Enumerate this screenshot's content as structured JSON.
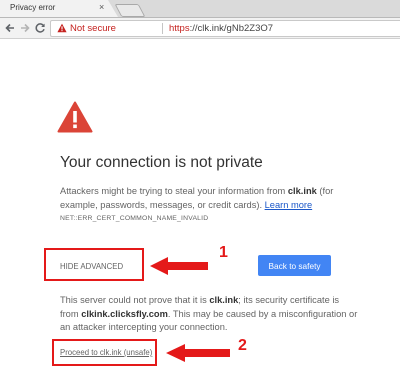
{
  "browser": {
    "tab_title": "Privacy error",
    "tab_close": "×",
    "security_label": "Not secure",
    "url_scheme": "https",
    "url_rest": "://clk.ink/gNb2Z3O7"
  },
  "page": {
    "heading": "Your connection is not private",
    "description_prefix": "Attackers might be trying to steal your information from ",
    "description_host": "clk.ink",
    "description_suffix": " (for example, passwords, messages, or credit cards). ",
    "learn_more": "Learn more",
    "error_code": "NET::ERR_CERT_COMMON_NAME_INVALID",
    "hide_advanced": "HIDE ADVANCED",
    "back_to_safety": "Back to safety",
    "detail_prefix": "This server could not prove that it is ",
    "detail_host": "clk.ink",
    "detail_mid": "; its security certificate is from ",
    "detail_cert_host": "clkink.clicksfly.com",
    "detail_suffix": ". This may be caused by a misconfiguration or an attacker intercepting your connection.",
    "proceed_link": "Proceed to clk.ink (unsafe)"
  },
  "annotations": {
    "marker_1": "1",
    "marker_2": "2",
    "color": "#e41919"
  },
  "colors": {
    "warning_red": "#c5221f",
    "primary_button": "#4285f4",
    "link": "#1a57c9"
  }
}
